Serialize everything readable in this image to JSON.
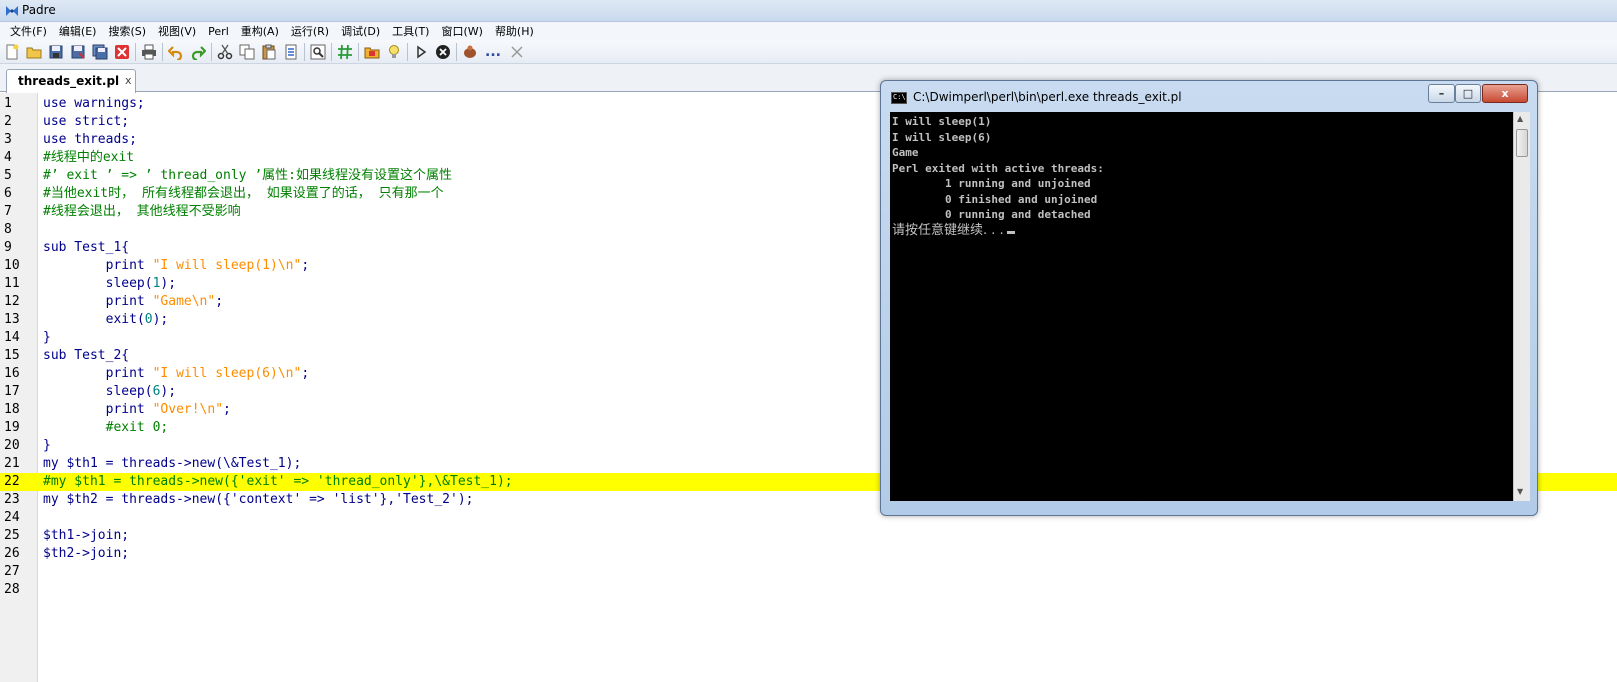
{
  "app": {
    "title": "Padre"
  },
  "colors": {
    "keyword": "#00008b",
    "plain": "#00008b",
    "string": "#ff8c00",
    "number": "#008080",
    "comment": "#008000",
    "current_line": "#ffff00"
  },
  "menu": [
    {
      "label": "文件(F)"
    },
    {
      "label": "编辑(E)"
    },
    {
      "label": "搜索(S)"
    },
    {
      "label": "视图(V)"
    },
    {
      "label": "Perl"
    },
    {
      "label": "重构(A)"
    },
    {
      "label": "运行(R)"
    },
    {
      "label": "调试(D)"
    },
    {
      "label": "工具(T)"
    },
    {
      "label": "窗口(W)"
    },
    {
      "label": "帮助(H)"
    }
  ],
  "toolbar": {
    "more_label": "...",
    "icons": [
      "new-file-icon",
      "open-file-icon",
      "save-icon",
      "save-as-icon",
      "save-all-icon",
      "close-file-icon",
      "print-icon",
      "undo-icon",
      "redo-icon",
      "cut-icon",
      "copy-icon",
      "paste-icon",
      "select-all-icon",
      "find-icon",
      "comment-icon",
      "open-project-icon",
      "hint-icon",
      "run-icon",
      "stop-icon",
      "debug-icon"
    ]
  },
  "tabs": [
    {
      "label": "threads_exit.pl",
      "close": "x"
    }
  ],
  "editor": {
    "current_line": 22,
    "lines": [
      {
        "n": "1",
        "tokens": [
          {
            "t": "use",
            "c": "keyword"
          },
          {
            "t": " warnings;",
            "c": "plain"
          }
        ]
      },
      {
        "n": "2",
        "tokens": [
          {
            "t": "use",
            "c": "keyword"
          },
          {
            "t": " strict;",
            "c": "plain"
          }
        ]
      },
      {
        "n": "3",
        "tokens": [
          {
            "t": "use",
            "c": "keyword"
          },
          {
            "t": " threads;",
            "c": "plain"
          }
        ]
      },
      {
        "n": "4",
        "tokens": [
          {
            "t": "#线程中的exit",
            "c": "comment"
          }
        ]
      },
      {
        "n": "5",
        "tokens": [
          {
            "t": "#’ exit ’ => ’ thread_only ’属性:如果线程没有设置这个属性",
            "c": "comment"
          }
        ]
      },
      {
        "n": "6",
        "tokens": [
          {
            "t": "#当他exit时， 所有线程都会退出， 如果设置了的话， 只有那一个",
            "c": "comment"
          }
        ]
      },
      {
        "n": "7",
        "tokens": [
          {
            "t": "#线程会退出， 其他线程不受影响",
            "c": "comment"
          }
        ]
      },
      {
        "n": "8",
        "tokens": []
      },
      {
        "n": "9",
        "tokens": [
          {
            "t": "sub",
            "c": "keyword"
          },
          {
            "t": " Test_1{",
            "c": "plain"
          }
        ]
      },
      {
        "n": "10",
        "tokens": [
          {
            "t": "        ",
            "c": "plain"
          },
          {
            "t": "print",
            "c": "keyword"
          },
          {
            "t": " ",
            "c": "plain"
          },
          {
            "t": "\"I will sleep(1)\\n\"",
            "c": "string"
          },
          {
            "t": ";",
            "c": "plain"
          }
        ]
      },
      {
        "n": "11",
        "tokens": [
          {
            "t": "        ",
            "c": "plain"
          },
          {
            "t": "sleep",
            "c": "keyword"
          },
          {
            "t": "(",
            "c": "plain"
          },
          {
            "t": "1",
            "c": "number"
          },
          {
            "t": ");",
            "c": "plain"
          }
        ]
      },
      {
        "n": "12",
        "tokens": [
          {
            "t": "        ",
            "c": "plain"
          },
          {
            "t": "print",
            "c": "keyword"
          },
          {
            "t": " ",
            "c": "plain"
          },
          {
            "t": "\"Game\\n\"",
            "c": "string"
          },
          {
            "t": ";",
            "c": "plain"
          }
        ]
      },
      {
        "n": "13",
        "tokens": [
          {
            "t": "        ",
            "c": "plain"
          },
          {
            "t": "exit",
            "c": "keyword"
          },
          {
            "t": "(",
            "c": "plain"
          },
          {
            "t": "0",
            "c": "number"
          },
          {
            "t": ");",
            "c": "plain"
          }
        ]
      },
      {
        "n": "14",
        "tokens": [
          {
            "t": "}",
            "c": "plain"
          }
        ]
      },
      {
        "n": "15",
        "tokens": [
          {
            "t": "sub",
            "c": "keyword"
          },
          {
            "t": " Test_2{",
            "c": "plain"
          }
        ]
      },
      {
        "n": "16",
        "tokens": [
          {
            "t": "        ",
            "c": "plain"
          },
          {
            "t": "print",
            "c": "keyword"
          },
          {
            "t": " ",
            "c": "plain"
          },
          {
            "t": "\"I will sleep(6)\\n\"",
            "c": "string"
          },
          {
            "t": ";",
            "c": "plain"
          }
        ]
      },
      {
        "n": "17",
        "tokens": [
          {
            "t": "        ",
            "c": "plain"
          },
          {
            "t": "sleep",
            "c": "keyword"
          },
          {
            "t": "(",
            "c": "plain"
          },
          {
            "t": "6",
            "c": "number"
          },
          {
            "t": ");",
            "c": "plain"
          }
        ]
      },
      {
        "n": "18",
        "tokens": [
          {
            "t": "        ",
            "c": "plain"
          },
          {
            "t": "print",
            "c": "keyword"
          },
          {
            "t": " ",
            "c": "plain"
          },
          {
            "t": "\"Over!\\n\"",
            "c": "string"
          },
          {
            "t": ";",
            "c": "plain"
          }
        ]
      },
      {
        "n": "19",
        "tokens": [
          {
            "t": "        ",
            "c": "plain"
          },
          {
            "t": "#exit 0;",
            "c": "comment"
          }
        ]
      },
      {
        "n": "20",
        "tokens": [
          {
            "t": "}",
            "c": "plain"
          }
        ]
      },
      {
        "n": "21",
        "tokens": [
          {
            "t": "my",
            "c": "keyword"
          },
          {
            "t": " $th1 = threads->new(\\&Test_1);",
            "c": "plain"
          }
        ]
      },
      {
        "n": "22",
        "tokens": [
          {
            "t": "#my $th1 = threads->new({'exit' => 'thread_only'},\\&Test_1);",
            "c": "comment"
          }
        ]
      },
      {
        "n": "23",
        "tokens": [
          {
            "t": "my",
            "c": "keyword"
          },
          {
            "t": " $th2 = threads->new({'context' => 'list'},'Test_2');",
            "c": "plain"
          }
        ]
      },
      {
        "n": "24",
        "tokens": []
      },
      {
        "n": "25",
        "tokens": [
          {
            "t": "$th1->join;",
            "c": "plain"
          }
        ]
      },
      {
        "n": "26",
        "tokens": [
          {
            "t": "$th2->join;",
            "c": "plain"
          }
        ]
      },
      {
        "n": "27",
        "tokens": []
      },
      {
        "n": "28",
        "tokens": []
      }
    ]
  },
  "console": {
    "icon_text": "C:\\",
    "title": "C:\\Dwimperl\\perl\\bin\\perl.exe  threads_exit.pl",
    "buttons": {
      "minimize": "–",
      "maximize": "□",
      "close": "x"
    },
    "lines": [
      "I will sleep(1)",
      "I will sleep(6)",
      "Game",
      "Perl exited with active threads:",
      "        1 running and unjoined",
      "        0 finished and unjoined",
      "        0 running and detached"
    ],
    "prompt": "请按任意键继续. . .",
    "scroll": {
      "up": "▲",
      "down": "▼"
    }
  }
}
